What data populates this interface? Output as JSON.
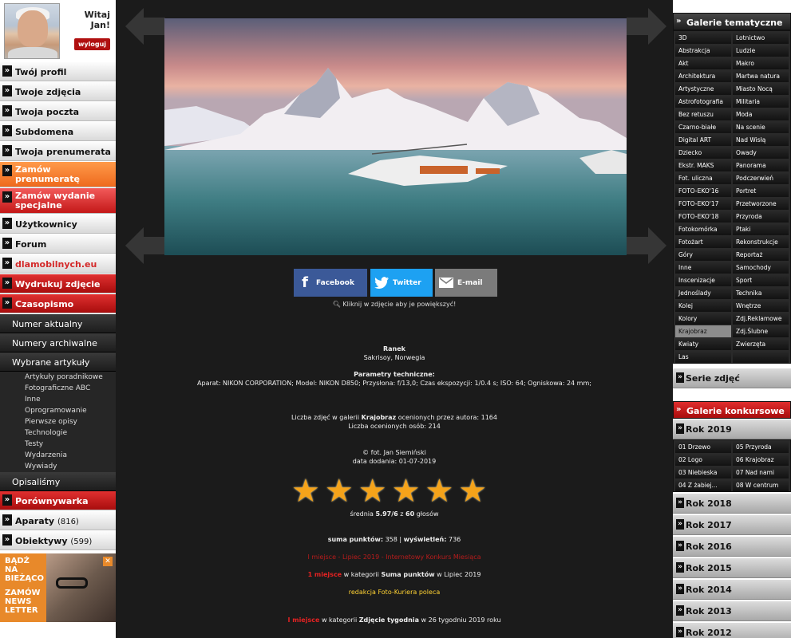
{
  "user": {
    "greeting": "Witaj Jan!",
    "logout": "wyloguj"
  },
  "left_menu": [
    {
      "label": "Twój profil",
      "style": "grey"
    },
    {
      "label": "Twoje zdjęcia",
      "style": "grey"
    },
    {
      "label": "Twoja poczta",
      "style": "grey"
    },
    {
      "label": "Subdomena",
      "style": "grey"
    },
    {
      "label": "Twoja prenumerata",
      "style": "grey"
    },
    {
      "label": "Zamów prenumeratę",
      "style": "orange"
    },
    {
      "label": "Zamów wydanie specjalne",
      "style": "red2"
    },
    {
      "label": "Użytkownicy",
      "style": "grey"
    },
    {
      "label": "Forum",
      "style": "grey"
    },
    {
      "label": "dlamobilnych.eu",
      "style": "redtext"
    },
    {
      "label": "Wydrukuj zdjęcie",
      "style": "redbar"
    },
    {
      "label": "Czasopismo",
      "style": "redbar"
    }
  ],
  "czasopismo": {
    "items": [
      "Numer aktualny",
      "Numery archiwalne",
      "Wybrane artykuły"
    ],
    "articles": [
      "Artykuły poradnikowe",
      "Fotograficzne ABC",
      "Inne",
      "Oprogramowanie",
      "Pierwsze opisy",
      "Technologie",
      "Testy",
      "Wydarzenia",
      "Wywiady"
    ],
    "after": "Opisaliśmy"
  },
  "porownywarka": {
    "title": "Porównywarka",
    "aparaty": "Aparaty",
    "aparaty_count": "(816)",
    "obiektywy": "Obiektywy",
    "obiektywy_count": "(599)"
  },
  "promo": {
    "line1": "BĄDŹ NA BIEŻĄCO",
    "line2": "ZAMÓW NEWS LETTER"
  },
  "share": {
    "facebook": "Facebook",
    "twitter": "Twitter",
    "email": "E-mail"
  },
  "hint": "Kliknij w zdjęcie aby je powiększyć!",
  "photo": {
    "title": "Ranek",
    "location": "Sakrisoy, Norwegia",
    "params_label": "Parametry techniczne:",
    "params": "Aparat: NIKON CORPORATION; Model: NIKON D850; Przysłona: f/13,0; Czas ekspozycji: 1/0.4 s; ISO: 64; Ogniskowa: 24 mm;",
    "gallery_count_prefix": "Liczba zdjęć w galerii",
    "gallery_name": "Krajobraz",
    "gallery_count_suffix": "ocenionych przez autora: 1164",
    "raters": "Liczba ocenionych osób: 214",
    "author_prefix": "© fot.",
    "author": "Jan Siemiński",
    "date": "data dodania: 01-07-2019",
    "rating_prefix": "średnia",
    "rating_value": "5.97/6",
    "rating_mid": "z",
    "votes": "60",
    "rating_suffix": "głosów",
    "points_label": "suma punktów:",
    "points": "358",
    "views_label": "wyświetleń:",
    "views": "736",
    "award1": "I miejsce - Lipiec 2019 - Internetowy Konkurs Miesiąca",
    "award2_place": "1 miejsce",
    "award2_mid": "w kategorii",
    "award2_cat": "Suma punktów",
    "award2_end": "w Lipiec 2019",
    "recommend": "redakcja Foto-Kuriera poleca",
    "award3_place": "I miejsce",
    "award3_mid": "w kategorii",
    "award3_cat": "Zdjęcie tygodnia",
    "award3_end": "w 26 tygodniu 2019 roku",
    "stars": 6
  },
  "galerie_tematyczne": {
    "title": "Galerie tematyczne",
    "items": [
      "3D",
      "Lotnictwo",
      "Abstrakcja",
      "Ludzie",
      "Akt",
      "Makro",
      "Architektura",
      "Martwa natura",
      "Artystyczne",
      "Miasto Nocą",
      "Astrofotografia",
      "Militaria",
      "Bez retuszu",
      "Moda",
      "Czarno-białe",
      "Na scenie",
      "Digital ART",
      "Nad Wisłą",
      "Dziecko",
      "Owady",
      "Ekstr. MAKS",
      "Panorama",
      "Fot. uliczna",
      "Podczerwień",
      "FOTO-EKO'16",
      "Portret",
      "FOTO-EKO'17",
      "Przetworzone",
      "FOTO-EKO'18",
      "Przyroda",
      "Fotokomórka",
      "Ptaki",
      "Fotożart",
      "Rekonstrukcje",
      "Góry",
      "Reportaż",
      "Inne",
      "Samochody",
      "Inscenizacje",
      "Sport",
      "Jednoślady",
      "Technika",
      "Kolej",
      "Wnętrze",
      "Kolory",
      "Zdj.Reklamowe",
      "Krajobraz",
      "Zdj.Ślubne",
      "Kwiaty",
      "Zwierzęta",
      "Las",
      ""
    ],
    "selected": "Krajobraz"
  },
  "serie": "Serie zdjęć",
  "konkursowe": {
    "title": "Galerie konkursowe",
    "year_open": "Rok 2019",
    "items": [
      "01 Drzewo",
      "05 Przyroda",
      "02 Logo",
      "06 Krajobraz",
      "03 Niebieska",
      "07 Nad nami",
      "04 Z żabiej...",
      "08 W centrum"
    ],
    "years": [
      "Rok 2018",
      "Rok 2017",
      "Rok 2016",
      "Rok 2015",
      "Rok 2014",
      "Rok 2013",
      "Rok 2012"
    ]
  },
  "colors": {
    "accent": "#c41818",
    "panel": "#1b1b1b",
    "facebook": "#3b5998",
    "twitter": "#1da1f2"
  }
}
